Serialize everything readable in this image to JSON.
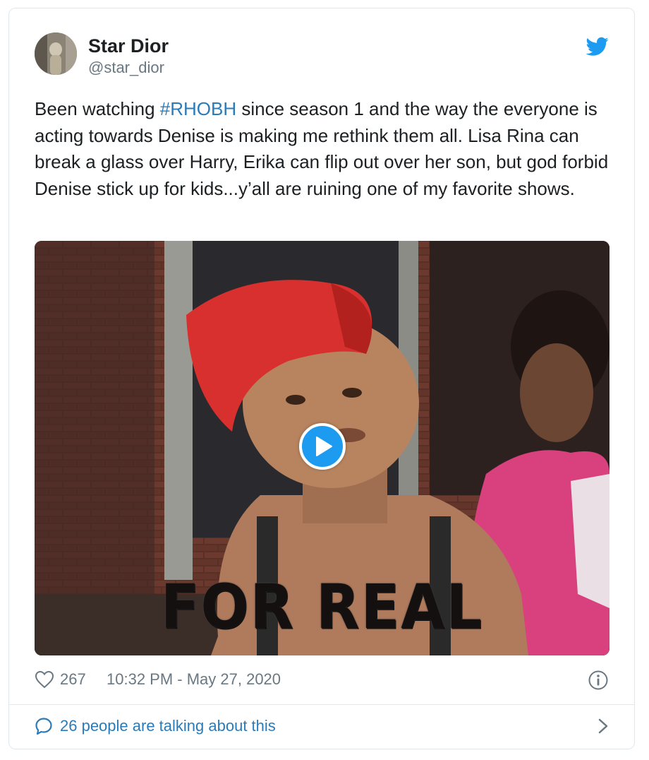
{
  "author": {
    "display_name": "Star Dior",
    "handle": "@star_dior",
    "avatar_icon": "avatar-photo"
  },
  "tweet": {
    "text_before": "Been watching ",
    "hashtag": "#RHOBH",
    "text_after": " since season 1 and the way the everyone is acting towards Denise is making me rethink them all. Lisa Rina can break a glass over Harry, Erika can flip out over her son, but god forbid Denise stick up for kids...y’all are ruining one of my favorite shows."
  },
  "media": {
    "caption": "FOR REAL",
    "play_icon": "play-icon"
  },
  "meta": {
    "like_count": "267",
    "timestamp": "10:32 PM - May 27, 2020"
  },
  "footer": {
    "talking_text": "26 people are talking about this"
  },
  "colors": {
    "brand_blue": "#1d9bf0",
    "link_blue": "#2b7bb9",
    "muted_gray": "#697882",
    "text": "#1c2022",
    "border": "#e1e8ed"
  }
}
